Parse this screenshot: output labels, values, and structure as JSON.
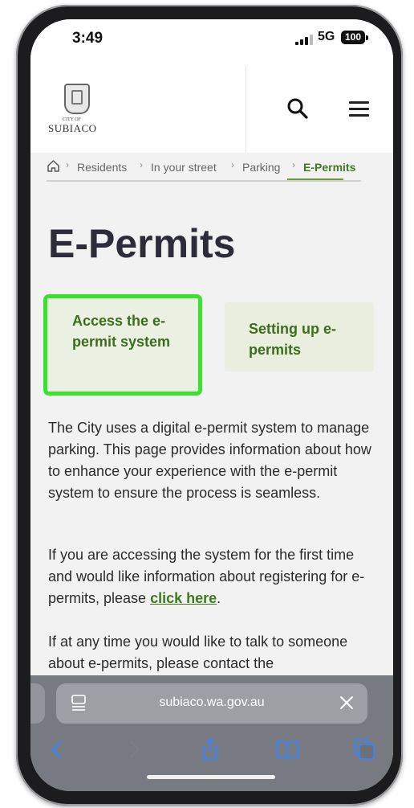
{
  "status_bar": {
    "time": "3:49",
    "network": "5G",
    "battery": "100"
  },
  "header": {
    "logo_small": "CITY OF",
    "logo_text": "SUBIACO",
    "search_icon": "search-icon",
    "menu_icon": "hamburger-menu-icon"
  },
  "breadcrumb": {
    "items": [
      "Residents",
      "In your street",
      "Parking"
    ],
    "current": "E-Permits"
  },
  "page": {
    "title": "E-Permits",
    "tiles": [
      "Access the e-permit system",
      "Setting up e-permits"
    ],
    "paragraphs": {
      "p1": "The City uses a digital e-permit system to manage parking. This page provides information about how to enhance your experience with the e-permit system to ensure the process is seamless.",
      "p2_text": "If you are accessing the system for the first time and would like information about registering for e-permits, please ",
      "p2_link": "click here",
      "p2_end": ".",
      "p3": "If at any time you would like to talk to someone about e-permits, please contact the"
    }
  },
  "browser": {
    "url": "subiaco.wa.gov.au",
    "toolbar": [
      "back-icon",
      "forward-icon",
      "share-icon",
      "bookmarks-icon",
      "tabs-icon"
    ]
  },
  "colors": {
    "accent_green": "#3f7a1f",
    "highlight": "#39e22c",
    "tile_bg": "#e9eedf",
    "title": "#2d2d3a"
  }
}
